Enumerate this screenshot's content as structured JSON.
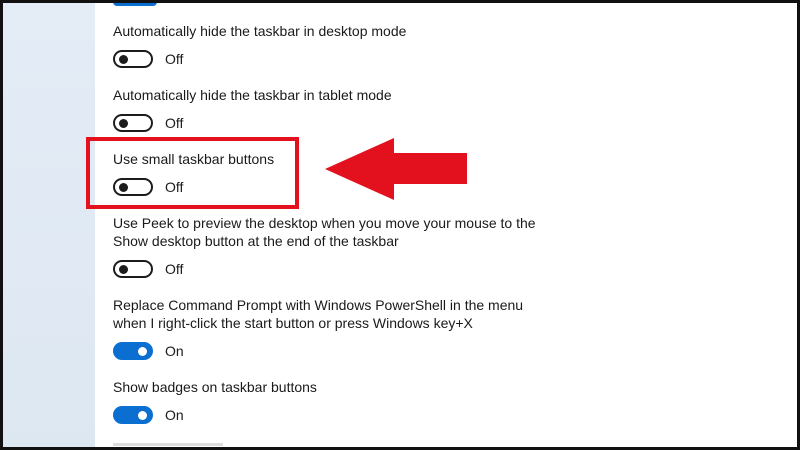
{
  "settings": [
    {
      "label_lines": [
        "Automatically hide the taskbar in desktop mode"
      ],
      "state": "Off"
    },
    {
      "label_lines": [
        "Automatically hide the taskbar in tablet mode"
      ],
      "state": "Off"
    },
    {
      "label_lines": [
        "Use small taskbar buttons"
      ],
      "state": "Off"
    },
    {
      "label_lines": [
        "Use Peek to preview the desktop when you move your mouse to the",
        "Show desktop button at the end of the taskbar"
      ],
      "state": "Off"
    },
    {
      "label_lines": [
        "Replace Command Prompt with Windows PowerShell in the menu",
        "when I right-click the start button or press Windows key+X"
      ],
      "state": "On"
    },
    {
      "label_lines": [
        "Show badges on taskbar buttons"
      ],
      "state": "On"
    }
  ],
  "colors": {
    "accent": "#0a6fd0",
    "annotation": "#e3101e"
  },
  "icons": {
    "annotation_arrow": "left-arrow-icon"
  }
}
